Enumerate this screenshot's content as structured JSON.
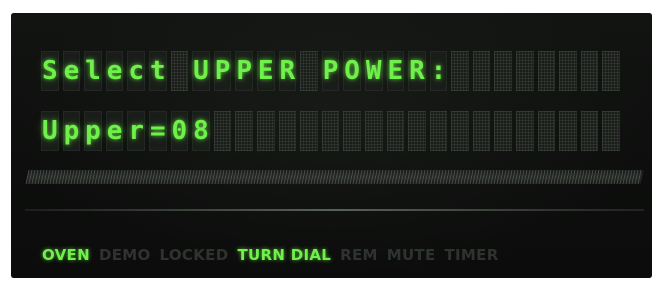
{
  "display": {
    "line1": "Select UPPER POWER:",
    "line2": "Upper=08"
  },
  "status_indicators": [
    {
      "label": "OVEN",
      "active": true
    },
    {
      "label": "DEMO",
      "active": false
    },
    {
      "label": "LOCKED",
      "active": false
    },
    {
      "label": "TURN DIAL",
      "active": true
    },
    {
      "label": "REM",
      "active": false
    },
    {
      "label": "MUTE",
      "active": false
    },
    {
      "label": "TIMER",
      "active": false
    }
  ],
  "colors": {
    "lit_segment": "#6ff04a",
    "unlit_segment": "#2f332f",
    "panel_background": "#0c0d0c"
  }
}
